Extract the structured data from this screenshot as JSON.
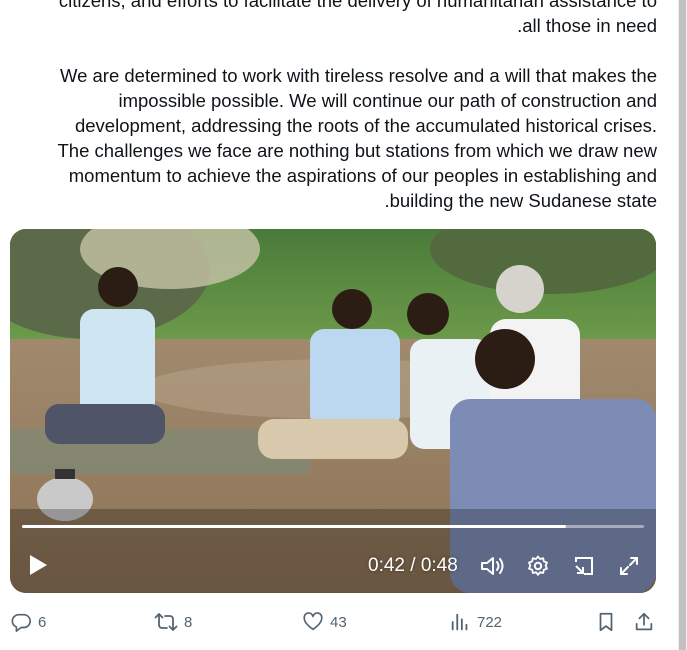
{
  "tweet": {
    "paragraph1_lines": [
      "citizens, and efforts to facilitate the delivery of humanitarian assistance to",
      ".all those in need"
    ],
    "paragraph2_lines": [
      "We are determined to work with tireless resolve and a will that makes the",
      "impossible possible. We will continue our path of construction and",
      "development, addressing the roots of the accumulated historical crises.",
      "The challenges we face are nothing but stations from which we draw new",
      "momentum to achieve the aspirations of our peoples in establishing and",
      ".building the new Sudanese state"
    ]
  },
  "video": {
    "time_display": "0:42 / 0:48",
    "progress_fraction": 0.875,
    "icons": {
      "play": "play-icon",
      "volume": "volume-icon",
      "settings": "gear-icon",
      "pip": "picture-in-picture-icon",
      "fullscreen": "fullscreen-icon"
    }
  },
  "actions": {
    "reply_count": "6",
    "retweet_count": "8",
    "like_count": "43",
    "views_count": "722"
  },
  "colors": {
    "text": "#0f1419",
    "muted": "#536471",
    "background": "#ffffff"
  }
}
